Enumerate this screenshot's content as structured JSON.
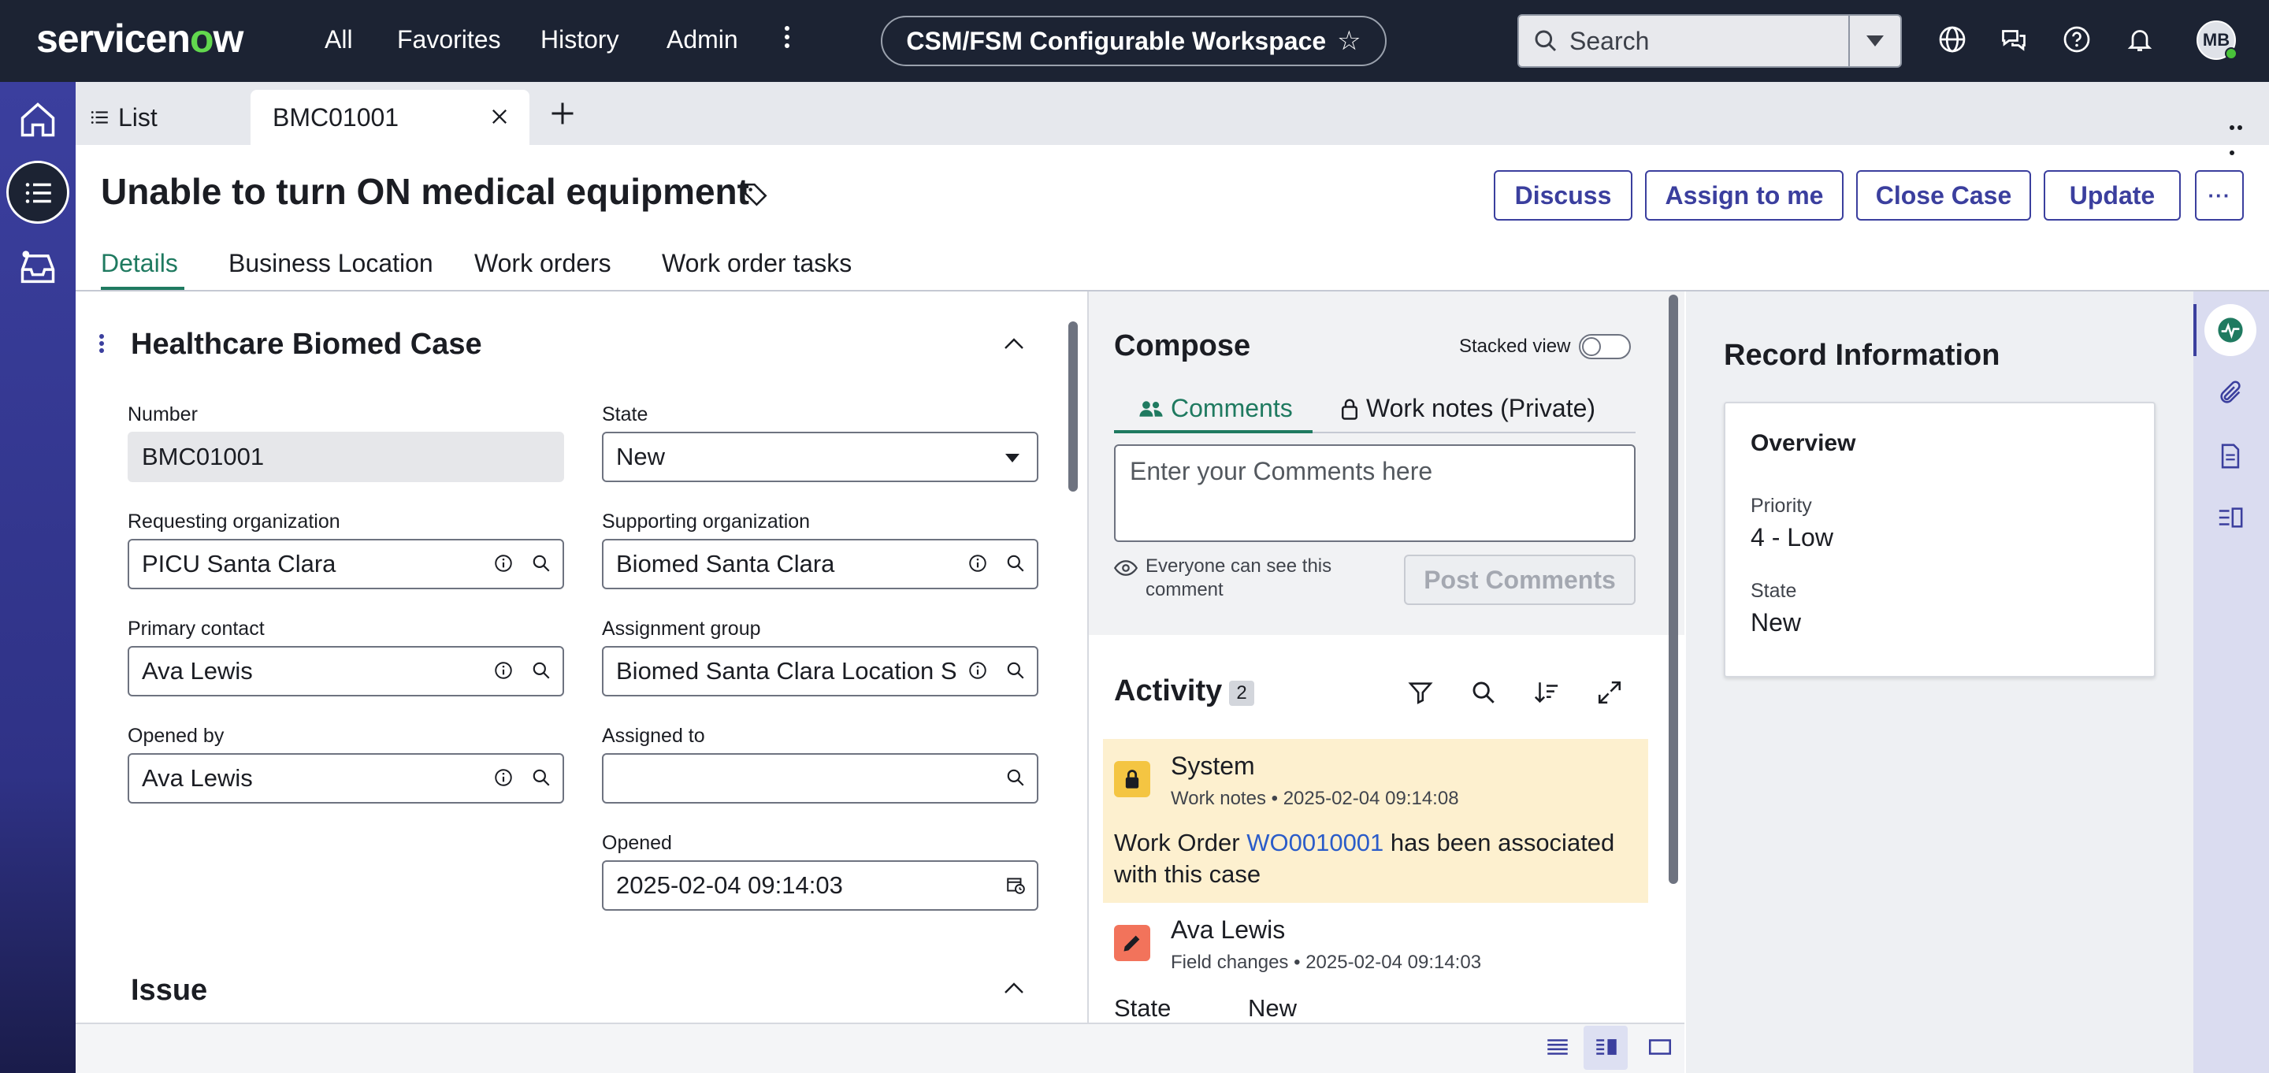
{
  "nav": {
    "brand_prefix": "servicen",
    "brand_o": "o",
    "brand_suffix": "w",
    "links": [
      "All",
      "Favorites",
      "History",
      "Admin"
    ],
    "workspace": "CSM/FSM Configurable Workspace",
    "search_placeholder": "Search",
    "avatar_initials": "MB"
  },
  "tabs": {
    "list_label": "List",
    "active_label": "BMC01001"
  },
  "header": {
    "title": "Unable to turn ON medical equipment",
    "actions": [
      "Discuss",
      "Assign to me",
      "Close Case",
      "Update"
    ],
    "subtabs": [
      "Details",
      "Business Location",
      "Work orders",
      "Work order tasks"
    ]
  },
  "form": {
    "section_title": "Healthcare Biomed Case",
    "section2_title": "Issue",
    "fields": {
      "number": {
        "label": "Number",
        "value": "BMC01001"
      },
      "state": {
        "label": "State",
        "value": "New"
      },
      "req_org": {
        "label": "Requesting organization",
        "value": "PICU Santa Clara"
      },
      "sup_org": {
        "label": "Supporting organization",
        "value": "Biomed Santa Clara"
      },
      "primary_contact": {
        "label": "Primary contact",
        "value": "Ava Lewis"
      },
      "assignment_group": {
        "label": "Assignment group",
        "value": "Biomed Santa Clara Location S"
      },
      "opened_by": {
        "label": "Opened by",
        "value": "Ava Lewis"
      },
      "assigned_to": {
        "label": "Assigned to",
        "value": ""
      },
      "opened": {
        "label": "Opened",
        "value": "2025-02-04 09:14:03"
      }
    }
  },
  "compose": {
    "title": "Compose",
    "stacked_label": "Stacked view",
    "tab_comments": "Comments",
    "tab_worknotes": "Work notes (Private)",
    "placeholder": "Enter your Comments here",
    "visibility_note": "Everyone can see this comment",
    "post_label": "Post Comments"
  },
  "activity": {
    "title": "Activity",
    "count": "2",
    "entries": [
      {
        "author": "System",
        "type": "Work notes",
        "timestamp": "2025-02-04 09:14:08",
        "text_before": "Work Order ",
        "link": "WO0010001",
        "text_after": " has been associated with this case"
      },
      {
        "author": "Ava Lewis",
        "type": "Field changes",
        "timestamp": "2025-02-04 09:14:03",
        "field_name": "State",
        "field_value": "New"
      }
    ]
  },
  "record": {
    "title": "Record Information",
    "card_title": "Overview",
    "priority_label": "Priority",
    "priority_value": "4 - Low",
    "state_label": "State",
    "state_value": "New"
  },
  "colors": {
    "nav_bg": "#1c2333",
    "accent": "#3b3f9e",
    "green": "#1f7a60",
    "worknote_bg": "#fdf0cf",
    "link": "#2b5cc9"
  }
}
